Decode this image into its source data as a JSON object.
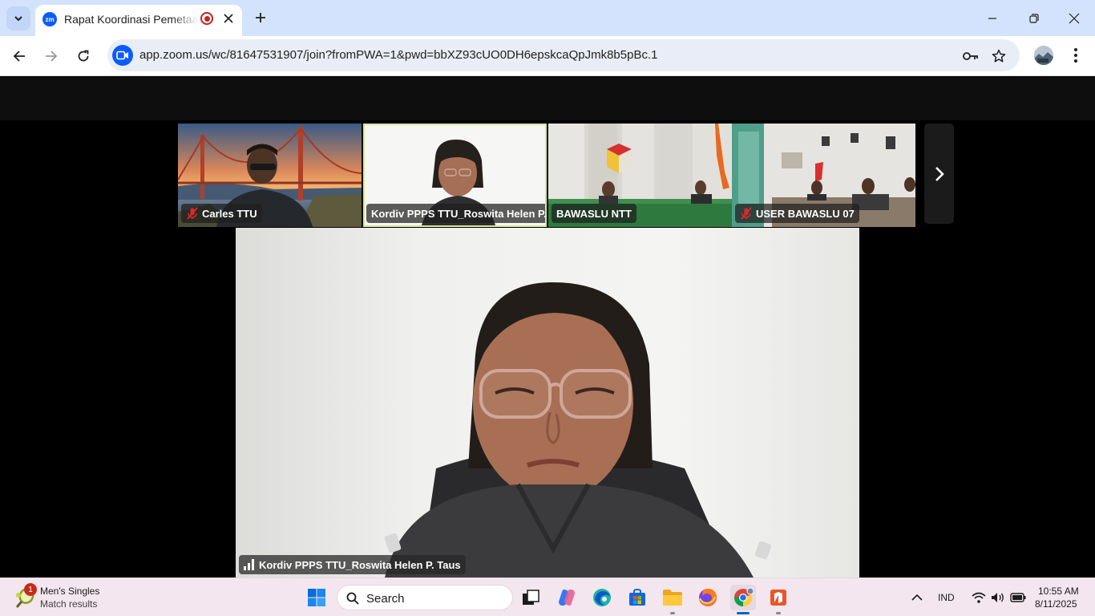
{
  "browser": {
    "tab": {
      "favicon_text": "zm",
      "title": "Rapat Koordinasi Pemetaan"
    },
    "url": "app.zoom.us/wc/81647531907/join?fromPWA=1&pwd=bbXZ93cUO0DH6epskcaQpJmk8b5pBc.1"
  },
  "meeting": {
    "thumbnails": [
      {
        "name": "Carles TTU",
        "muted": true
      },
      {
        "name": "Kordiv PPPS TTU_Roswita Helen P. ...",
        "muted": false,
        "active": true
      },
      {
        "name": "BAWASLU NTT",
        "muted": false
      },
      {
        "name": "USER BAWASLU 07",
        "muted": true
      }
    ],
    "active_speaker": {
      "name": "Kordiv PPPS TTU_Roswita Helen P. Taus"
    }
  },
  "taskbar": {
    "widget": {
      "badge": "1",
      "title": "Men's Singles",
      "subtitle": "Match results"
    },
    "search_placeholder": "Search",
    "language": "IND",
    "time": "10:55 AM",
    "date": "8/11/2025"
  },
  "colors": {
    "tab_bar": "#d3e3fd",
    "zoom_blue": "#0b5cff",
    "taskbar": "#f3e6ee",
    "active_border": "#d6e89a"
  }
}
